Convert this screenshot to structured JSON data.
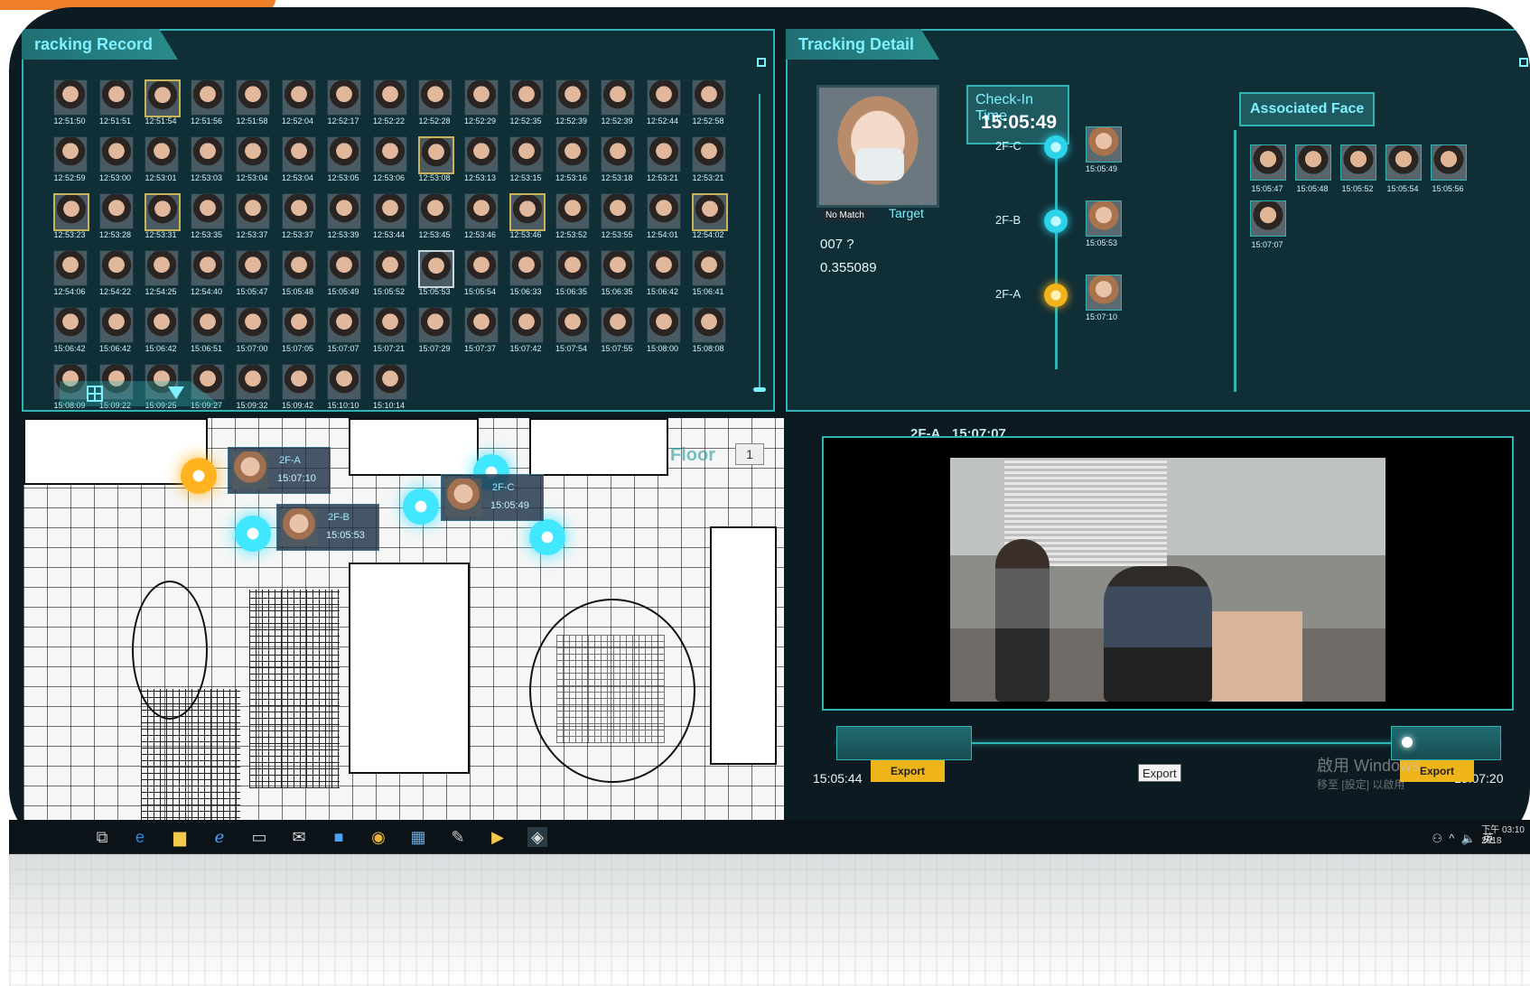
{
  "tracking_record": {
    "title": "racking Record",
    "rows": [
      [
        "12:51:50",
        "12:51:51",
        "12:51:54",
        "12:51:56",
        "12:51:58",
        "12:52:04",
        "12:52:17",
        "12:52:22",
        "12:52:28",
        "12:52:29",
        "12:52:35",
        "12:52:39",
        "12:52:39",
        "12:52:44",
        "12:52:58"
      ],
      [
        "12:52:59",
        "12:53:00",
        "12:53:01",
        "12:53:03",
        "12:53:04",
        "12:53:04",
        "12:53:05",
        "12:53:06",
        "12:53:08",
        "12:53:13",
        "12:53:15",
        "12:53:16",
        "12:53:18",
        "12:53:21",
        "12:53:21"
      ],
      [
        "12:53:23",
        "12:53:28",
        "12:53:31",
        "12:53:35",
        "12:53:37",
        "12:53:37",
        "12:53:39",
        "12:53:44",
        "12:53:45",
        "12:53:46",
        "12:53:46",
        "12:53:52",
        "12:53:55",
        "12:54:01",
        "12:54:02"
      ],
      [
        "12:54:06",
        "12:54:22",
        "12:54:25",
        "12:54:40",
        "15:05:47",
        "15:05:48",
        "15:05:49",
        "15:05:52",
        "15:05:53",
        "15:05:54",
        "15:06:33",
        "15:06:35",
        "15:06:35",
        "15:06:42",
        "15:06:41"
      ],
      [
        "15:06:42",
        "15:06:42",
        "15:06:42",
        "15:06:51",
        "15:07:00",
        "15:07:05",
        "15:07:07",
        "15:07:21",
        "15:07:29",
        "15:07:37",
        "15:07:42",
        "15:07:54",
        "15:07:55",
        "15:08:00",
        "15:08:08"
      ],
      [
        "15:08:09",
        "15:09:22",
        "15:09:25",
        "15:09:27",
        "15:09:32",
        "15:09:42",
        "15:10:10",
        "15:10:14"
      ]
    ]
  },
  "tracking_detail": {
    "title": "Tracking Detail",
    "target_badge": "No Match",
    "target_label": "Target",
    "id": "007 ?",
    "score": "0.355089",
    "checkin_title": "Check-In Time",
    "checkin_time": "15:05:49",
    "timeline": [
      {
        "cam": "2F-C",
        "time": "15:05:49",
        "state": "cyan"
      },
      {
        "cam": "2F-B",
        "time": "15:05:53",
        "state": "cyan"
      },
      {
        "cam": "2F-A",
        "time": "15:07:10",
        "state": "amber"
      }
    ],
    "assoc_title": "Associated Face",
    "assoc_faces": [
      "15:05:47",
      "15:05:48",
      "15:05:52",
      "15:05:54",
      "15:05:56",
      "15:07:07"
    ]
  },
  "floorplan": {
    "page": "1",
    "floor_word": "Floor",
    "cards": [
      {
        "loc": "2F-A",
        "time": "15:07:10"
      },
      {
        "loc": "2F-B",
        "time": "15:05:53"
      },
      {
        "loc": "2F-C",
        "time": "15:05:49"
      }
    ]
  },
  "video": {
    "cam": "2F-A",
    "time": "15:07:07",
    "start_time": "15:05:44",
    "end_time": "15:07:20",
    "export_label": "Export",
    "watermark": "啟用 Windows",
    "watermark_sub": "移至 [設定] 以啟用"
  },
  "taskbar": {
    "tray_text": "英",
    "clock_line1": "下午 03:10",
    "clock_line2": "2018"
  },
  "colors": {
    "accent": "#2fb3b3",
    "highlight": "#7ff0ff",
    "export": "#f0b41b",
    "amber": "#f2b21a"
  }
}
